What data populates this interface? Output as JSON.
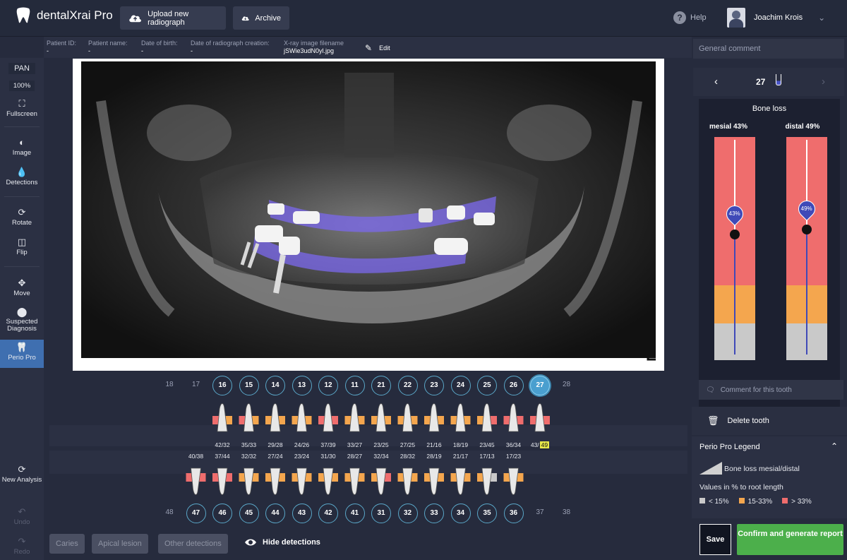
{
  "app": {
    "name": "dentalXrai Pro",
    "upload_label": "Upload new radiograph",
    "archive_label": "Archive",
    "help_label": "Help",
    "user_name": "Joachim Krois"
  },
  "patient": {
    "id_label": "Patient ID:",
    "id_value": "-",
    "name_label": "Patient name:",
    "name_value": "-",
    "dob_label": "Date of birth:",
    "dob_value": "-",
    "date_label": "Date of radiograph creation:",
    "date_value": "-",
    "file_label": "X-ray image filename",
    "file_value": "jSWie3udN0yl.jpg",
    "edit_label": "Edit"
  },
  "left_sidebar": {
    "mode": "PAN",
    "zoom": "100%",
    "fullscreen": "Fullscreen",
    "image": "Image",
    "detections": "Detections",
    "rotate": "Rotate",
    "flip": "Flip",
    "move": "Move",
    "suspected": "Suspected Diagnosis",
    "perio": "Perio Pro",
    "new_analysis": "New Analysis",
    "undo": "Undo",
    "redo": "Redo"
  },
  "upper_teeth": [
    {
      "n": "18",
      "active": false
    },
    {
      "n": "17",
      "active": false
    },
    {
      "n": "16",
      "active": true
    },
    {
      "n": "15",
      "active": true
    },
    {
      "n": "14",
      "active": true
    },
    {
      "n": "13",
      "active": true
    },
    {
      "n": "12",
      "active": true
    },
    {
      "n": "11",
      "active": true
    },
    {
      "n": "21",
      "active": true
    },
    {
      "n": "22",
      "active": true
    },
    {
      "n": "23",
      "active": true
    },
    {
      "n": "24",
      "active": true
    },
    {
      "n": "25",
      "active": true
    },
    {
      "n": "26",
      "active": true
    },
    {
      "n": "27",
      "active": true,
      "selected": true
    },
    {
      "n": "28",
      "active": false
    }
  ],
  "lower_teeth": [
    {
      "n": "48",
      "active": false
    },
    {
      "n": "47",
      "active": true
    },
    {
      "n": "46",
      "active": true
    },
    {
      "n": "45",
      "active": true
    },
    {
      "n": "44",
      "active": true
    },
    {
      "n": "43",
      "active": true
    },
    {
      "n": "42",
      "active": true
    },
    {
      "n": "41",
      "active": true
    },
    {
      "n": "31",
      "active": true
    },
    {
      "n": "32",
      "active": true
    },
    {
      "n": "33",
      "active": true
    },
    {
      "n": "34",
      "active": true
    },
    {
      "n": "35",
      "active": true
    },
    {
      "n": "36",
      "active": true
    },
    {
      "n": "37",
      "active": false
    },
    {
      "n": "38",
      "active": false
    }
  ],
  "upper_bone_loss": [
    "42/32",
    "35/33",
    "29/28",
    "24/26",
    "37/39",
    "33/27",
    "23/25",
    "27/25",
    "21/16",
    "18/19",
    "23/45",
    "36/34",
    "43/"
  ],
  "upper_highlight": "49",
  "lower_bone_loss": [
    "40/38",
    "37/44",
    "32/32",
    "27/24",
    "23/24",
    "31/30",
    "28/27",
    "32/34",
    "28/32",
    "28/19",
    "21/17",
    "17/13",
    "17/23"
  ],
  "footer": {
    "caries": "Caries",
    "apical": "Apical lesion",
    "other": "Other detections",
    "hide": "Hide detections"
  },
  "right": {
    "general_comment": "General comment",
    "tooth": "27",
    "bone_loss_title": "Bone loss",
    "mesial_label": "mesial 43%",
    "distal_label": "distal 49%",
    "mesial_value": 43,
    "distal_value": 49,
    "mesial_pin": "43%",
    "distal_pin": "49%",
    "comment_tooth": "Comment for this tooth",
    "delete_tooth": "Delete tooth",
    "legend_title": "Perio Pro Legend",
    "legend_bone": "Bone loss mesial/distal",
    "legend_values": "Values in % to root length",
    "legend_low": "< 15%",
    "legend_mid": "15-33%",
    "legend_high": "> 33%",
    "save": "Save",
    "confirm": "Confirm and generate report"
  },
  "colors": {
    "accent": "#4a9fcf",
    "low": "#c9c9c9",
    "mid": "#f4a64e",
    "high": "#ef6d6d",
    "confirm": "#4caf4b",
    "overlay": "#7b68ee"
  }
}
